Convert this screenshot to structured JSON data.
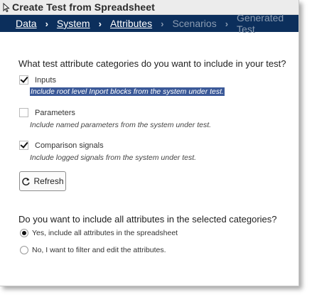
{
  "window": {
    "title": "Create Test from Spreadsheet"
  },
  "breadcrumb": {
    "items": [
      {
        "label": "Data",
        "enabled": true
      },
      {
        "label": "System",
        "enabled": true
      },
      {
        "label": "Attributes",
        "enabled": true
      },
      {
        "label": "Scenarios",
        "enabled": false
      },
      {
        "label": "Generated Test",
        "enabled": false
      }
    ],
    "separator": "›"
  },
  "categories": {
    "question": "What test attribute categories do you want to include in your test?",
    "items": [
      {
        "label": "Inputs",
        "checked": true,
        "description": "Include root level Inport blocks from the system under test."
      },
      {
        "label": "Parameters",
        "checked": false,
        "description": "Include named parameters from the system under test."
      },
      {
        "label": "Comparison signals",
        "checked": true,
        "description": "Include logged signals from the system under test."
      }
    ]
  },
  "refresh": {
    "label": "Refresh",
    "icon": "refresh-icon"
  },
  "attributes": {
    "question": "Do you want to include all attributes in the selected categories?",
    "options": [
      {
        "label": "Yes, include all attributes in the spreadsheet",
        "selected": true
      },
      {
        "label": "No, I want to filter and edit the attributes.",
        "selected": false
      }
    ]
  },
  "colors": {
    "breadcrumb_bg": "#0c2f5c",
    "selection_bg": "#3b5998"
  }
}
